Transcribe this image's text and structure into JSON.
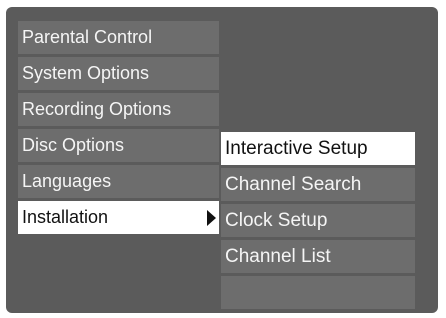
{
  "main_menu": {
    "items": [
      {
        "label": "Parental Control"
      },
      {
        "label": "System Options"
      },
      {
        "label": "Recording Options"
      },
      {
        "label": "Disc Options"
      },
      {
        "label": "Languages"
      },
      {
        "label": "Installation"
      }
    ],
    "selected_index": 5
  },
  "sub_menu": {
    "items": [
      {
        "label": "Interactive Setup"
      },
      {
        "label": "Channel Search"
      },
      {
        "label": "Clock Setup"
      },
      {
        "label": "Channel List"
      },
      {
        "label": ""
      }
    ],
    "selected_index": 0
  },
  "icons": {
    "submenu_indicator": "play-arrow-right"
  },
  "colors": {
    "background": "#5b5b5b",
    "item_background": "#6d6d6d",
    "item_text": "#f5f5f5",
    "selected_background": "#ffffff",
    "selected_text": "#111111"
  }
}
